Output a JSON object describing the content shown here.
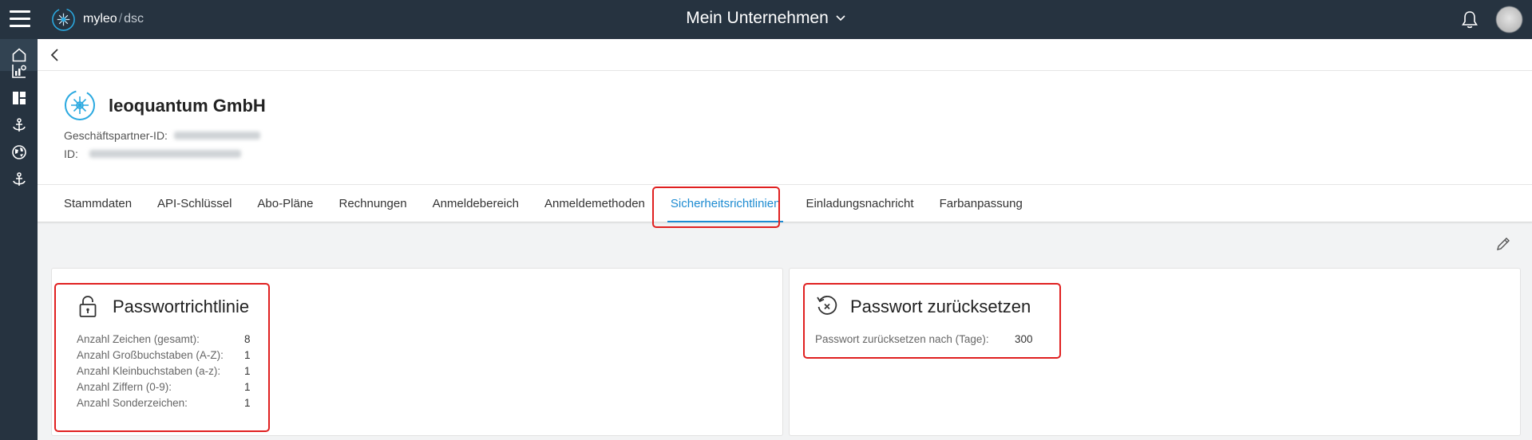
{
  "app": {
    "brand_primary": "myleo",
    "brand_sep": "/",
    "brand_secondary": "dsc",
    "org_name": "Mein Unternehmen"
  },
  "sidebar": {
    "items": [
      {
        "icon": "home-icon",
        "active": true
      },
      {
        "icon": "chart-settings-icon"
      },
      {
        "icon": "dashboard-icon"
      },
      {
        "icon": "anchor-icon"
      },
      {
        "icon": "globe-icon"
      },
      {
        "icon": "anchor-icon"
      }
    ]
  },
  "company": {
    "name": "leoquantum GmbH",
    "partner_id_label": "Geschäftspartner-ID:",
    "id_label": "ID:"
  },
  "tabs": [
    {
      "label": "Stammdaten"
    },
    {
      "label": "API-Schlüssel"
    },
    {
      "label": "Abo-Pläne"
    },
    {
      "label": "Rechnungen"
    },
    {
      "label": "Anmeldebereich"
    },
    {
      "label": "Anmeldemethoden"
    },
    {
      "label": "Sicherheitsrichtlinien",
      "active": true
    },
    {
      "label": "Einladungsnachricht"
    },
    {
      "label": "Farbanpassung"
    }
  ],
  "password_policy": {
    "title": "Passwortrichtlinie",
    "rows": [
      {
        "label": "Anzahl Zeichen (gesamt):",
        "value": "8"
      },
      {
        "label": "Anzahl Großbuchstaben (A-Z):",
        "value": "1"
      },
      {
        "label": "Anzahl Kleinbuchstaben (a-z):",
        "value": "1"
      },
      {
        "label": "Anzahl Ziffern (0-9):",
        "value": "1"
      },
      {
        "label": "Anzahl Sonderzeichen:",
        "value": "1"
      }
    ]
  },
  "password_reset": {
    "title": "Passwort zurücksetzen",
    "label": "Passwort zurücksetzen nach (Tage):",
    "value": "300"
  },
  "colors": {
    "topbar": "#263340",
    "accent": "#1d8bd1",
    "highlight": "#e02020"
  }
}
